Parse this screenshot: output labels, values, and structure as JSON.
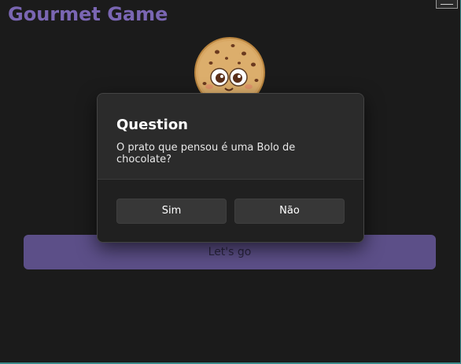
{
  "app": {
    "title": "Gourmet Game",
    "accent_color": "#7a66b3",
    "menu_icon": "hamburger-icon"
  },
  "mascot": {
    "icon": "cookie-mascot-icon"
  },
  "main": {
    "start_button_label": "Let's go"
  },
  "dialog": {
    "title": "Question",
    "message": "O prato que pensou é uma Bolo de chocolate?",
    "yes_label": "Sim",
    "no_label": "Não"
  }
}
